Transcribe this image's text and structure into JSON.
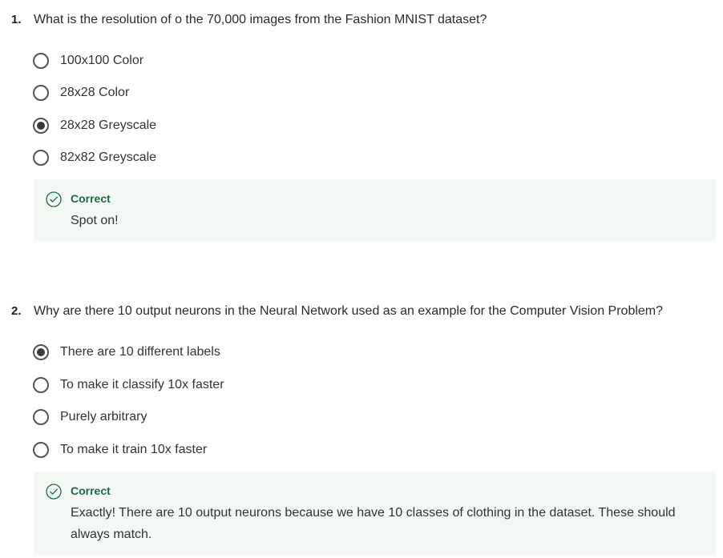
{
  "questions": [
    {
      "number": "1.",
      "text": "What is the resolution of o the 70,000 images from the Fashion MNIST dataset?",
      "options": [
        {
          "label": "100x100 Color",
          "selected": false
        },
        {
          "label": "28x28 Color",
          "selected": false
        },
        {
          "label": "28x28 Greyscale",
          "selected": true
        },
        {
          "label": "82x82 Greyscale",
          "selected": false
        }
      ],
      "feedback": {
        "status": "Correct",
        "message": "Spot on!",
        "icon": "check-circle-icon"
      }
    },
    {
      "number": "2.",
      "text": "Why are there 10 output neurons in the Neural Network used as an example for the Computer Vision Problem?",
      "options": [
        {
          "label": "There are 10 different labels",
          "selected": true
        },
        {
          "label": "To make it classify 10x faster",
          "selected": false
        },
        {
          "label": "Purely arbitrary",
          "selected": false
        },
        {
          "label": "To make it train 10x faster",
          "selected": false
        }
      ],
      "feedback": {
        "status": "Correct",
        "message": "Exactly! There are 10 output neurons because we have 10 classes of clothing in the dataset. These should always match.",
        "icon": "check-circle-icon"
      }
    }
  ],
  "colors": {
    "correct_green": "#1e6b3e",
    "feedback_bg": "#f4f8f5"
  }
}
